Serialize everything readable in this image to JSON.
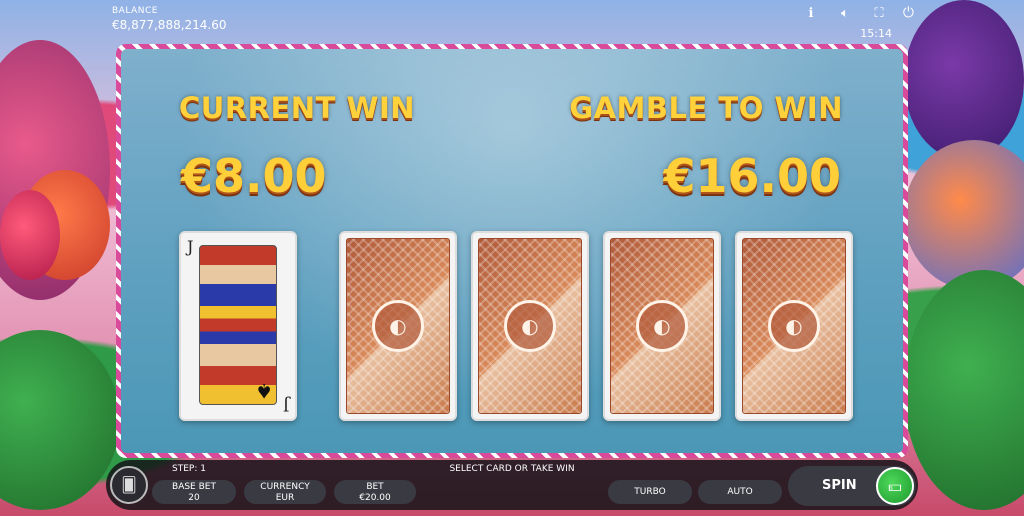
{
  "top_bar": {
    "balance_label": "BALANCE",
    "balance_value": "€8,877,888,214.60",
    "time": "15:14",
    "icons": [
      "info-icon",
      "sound-icon",
      "fullscreen-icon",
      "power-icon"
    ]
  },
  "gamble": {
    "current_win_label": "CURRENT WIN",
    "current_win_value": "€8.00",
    "gamble_to_win_label": "GAMBLE TO WIN",
    "gamble_to_win_value": "€16.00",
    "dealer_card": {
      "rank": "J",
      "suit": "♠"
    },
    "face_down_cards": 4
  },
  "controls": {
    "step": "STEP: 1",
    "hint": "SELECT CARD OR TAKE WIN",
    "base_bet_label": "BASE BET",
    "base_bet_value": "20",
    "currency_label": "CURRENCY",
    "currency_value": "EUR",
    "bet_label": "BET",
    "bet_value": "€20.00",
    "turbo_label": "TURBO",
    "auto_label": "AUTO",
    "spin_label": "SPIN"
  },
  "colors": {
    "win_text": "#ffd23c",
    "panel_border": "#d94a9a",
    "spin_button": "#2fb83f"
  }
}
